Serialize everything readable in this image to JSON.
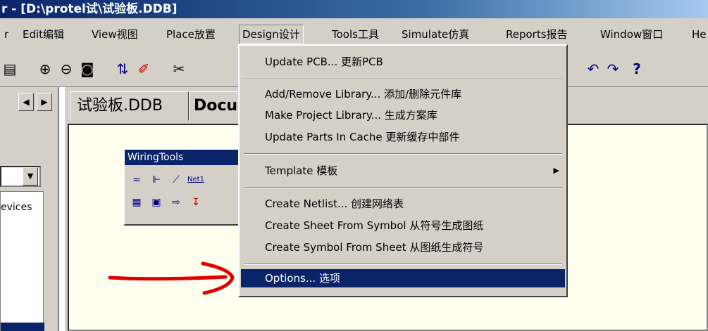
{
  "window": {
    "title": "r - [D:\\protel试\\试验板.DDB]"
  },
  "menubar": {
    "items": [
      {
        "label": "r"
      },
      {
        "label": "Edit编辑"
      },
      {
        "label": "View视图"
      },
      {
        "label": "Place放置"
      },
      {
        "label": "Design设计"
      },
      {
        "label": "Tools工具"
      },
      {
        "label": "Simulate仿真"
      },
      {
        "label": "Reports报告"
      },
      {
        "label": "Window窗口"
      },
      {
        "label": "He"
      }
    ]
  },
  "tabs": [
    {
      "label": "试验板.DDB"
    },
    {
      "label": "Docu"
    }
  ],
  "left_panel": {
    "tree_label": "evices"
  },
  "wiring_tools": {
    "title": "WiringTools",
    "net_label": "Net1"
  },
  "design_menu": {
    "items": [
      {
        "label": "Update PCB...  更新PCB"
      },
      {
        "label": "Add/Remove Library...  添加/删除元件库"
      },
      {
        "label": "Make Project Library...  生成方案库"
      },
      {
        "label": "Update Parts In Cache  更新缓存中部件"
      },
      {
        "label": "Template  模板"
      },
      {
        "label": "Create Netlist...  创建网络表"
      },
      {
        "label": "Create Sheet From Symbol  从符号生成图纸"
      },
      {
        "label": "Create Symbol From Sheet  从图纸生成符号"
      },
      {
        "label": "Options...  选项"
      }
    ],
    "submenu_arrow": "▶"
  },
  "toolbar_icons": {
    "help_glyph": "?"
  },
  "colors": {
    "titlebar": "#0a246a",
    "menu_bg": "#d4d0c8",
    "selected": "#0a246a",
    "canvas": "#fffff0",
    "annotation_arrow": "#e00000"
  }
}
